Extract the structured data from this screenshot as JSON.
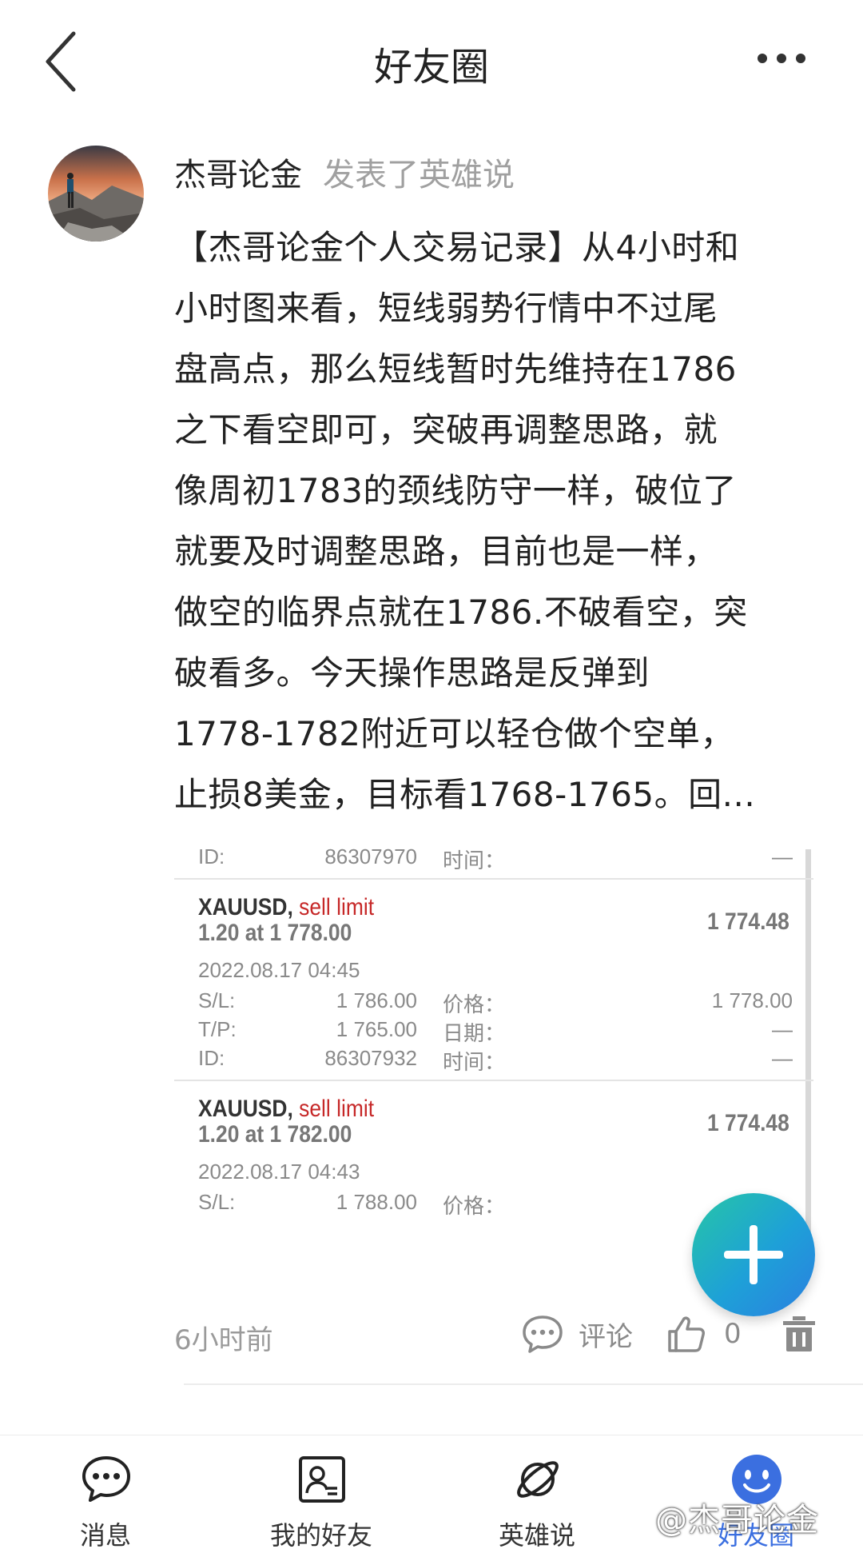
{
  "header": {
    "title": "好友圈",
    "back_icon": "chevron-left-icon",
    "more_icon": "more-horizontal-icon"
  },
  "post": {
    "author": "杰哥论金",
    "action": "发表了英雄说",
    "lines": [
      "【杰哥论金个人交易记录】从4小时和",
      "小时图来看，短线弱势行情中不过尾",
      "盘高点，那么短线暂时先维持在1786",
      "之下看空即可，突破再调整思路，就",
      "像周初1783的颈线防守一样，破位了",
      "就要及时调整思路，目前也是一样，",
      "做空的临界点就在1786.不破看空，突",
      "破看多。今天操作思路是反弹到",
      "1778-1782附近可以轻仓做个空单，",
      "止损8美金，目标看1768-1765。回..."
    ],
    "time": "6小时前",
    "comment_label": "评论",
    "like_count": "0"
  },
  "embed": {
    "top_row": {
      "id_label": "ID:",
      "id_value": "86307970",
      "time_label": "时间：",
      "time_value": "—"
    },
    "orders": [
      {
        "symbol": "XAUUSD,",
        "type": "sell limit",
        "lots": "1.20 at 1 778.00",
        "price": "1 774.48",
        "datetime": "2022.08.17 04:45",
        "sl_label": "S/L:",
        "sl": "1 786.00",
        "price_label": "价格：",
        "price_value": "1 778.00",
        "tp_label": "T/P:",
        "tp": "1 765.00",
        "date_label": "日期：",
        "date_value": "—",
        "id_label": "ID:",
        "id_value": "86307932",
        "time_label": "时间：",
        "time_value": "—"
      },
      {
        "symbol": "XAUUSD,",
        "type": "sell limit",
        "lots": "1.20 at 1 782.00",
        "price": "1 774.48",
        "datetime": "2022.08.17 04:43",
        "sl_label": "S/L:",
        "sl": "1 788.00",
        "price_label": "价格："
      }
    ]
  },
  "fab": {
    "icon": "plus-icon"
  },
  "bottom_nav": {
    "items": [
      {
        "label": "消息",
        "icon": "chat-bubble-icon"
      },
      {
        "label": "我的好友",
        "icon": "contact-card-icon"
      },
      {
        "label": "英雄说",
        "icon": "planet-icon"
      },
      {
        "label": "好友圈",
        "icon": "smiley-face-icon",
        "active": true
      }
    ]
  },
  "watermark": "@杰哥论金",
  "colors": {
    "accent": "#3b6fe0",
    "sell_limit": "#c62828",
    "fab_start": "#26c6a6",
    "fab_end": "#2b7fe0"
  }
}
